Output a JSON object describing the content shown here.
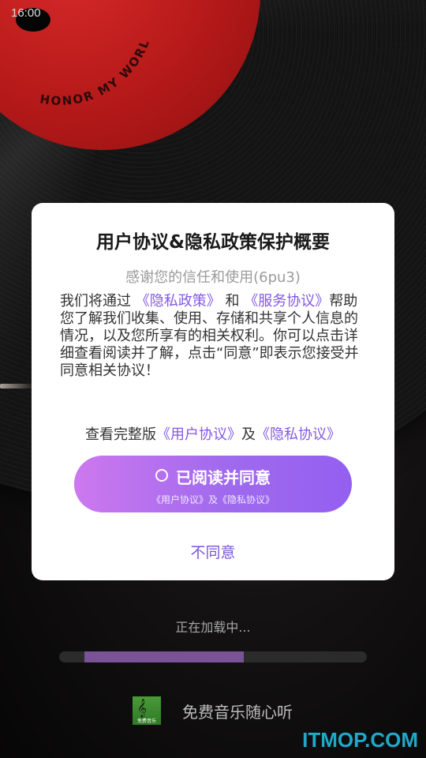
{
  "status_bar": {
    "time": "16:00"
  },
  "background": {
    "record_label_text": "HONOR MY WORLD"
  },
  "dialog": {
    "title": "用户协议&隐私政策保护概要",
    "subtitle": "感谢您的信任和使用(6pu3)",
    "body": {
      "lead": "我们将通过",
      "privacy_link": "《隐私政策》",
      "and": "和",
      "service_link": "《服务协议》",
      "rest": "帮助您了解我们收集、使用、存储和共享个人信息的情况，以及您所享有的相关权利。你可以点击详细查看阅读并了解，点击“同意”即表示您接受并同意相关协议！"
    },
    "full_version": {
      "prefix": "查看完整版",
      "user_link": "《用户协议》",
      "and": "及",
      "privacy_link": "《隐私协议》"
    },
    "agree_button": {
      "label": "已阅读并同意",
      "sub_label": "《用户协议》及《隐私协议》",
      "icon": "circle-icon"
    },
    "disagree_label": "不同意",
    "colors": {
      "link": "#8458e6",
      "button_start": "#cd78ee",
      "button_end": "#945ff0"
    }
  },
  "loading": {
    "text": "正在加载中...",
    "progress": 0.62
  },
  "footer": {
    "app_icon_text": "免费音乐",
    "slogan": "免费音乐随心听"
  },
  "watermark": "ITMOP.COM"
}
